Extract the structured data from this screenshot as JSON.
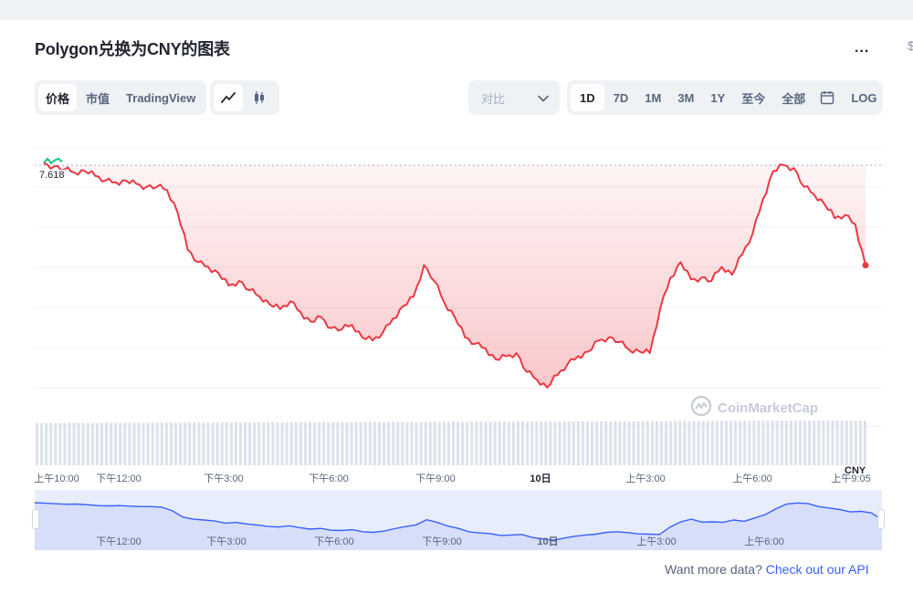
{
  "title": "Polygon兑换为CNY的图表",
  "more_label": "...",
  "right_edge_glyph": "$",
  "view_tabs": [
    {
      "label": "价格",
      "active": true
    },
    {
      "label": "市值",
      "active": false
    },
    {
      "label": "TradingView",
      "active": false
    }
  ],
  "chart_type_icons": [
    "line-chart-icon",
    "candlestick-icon"
  ],
  "compare": {
    "label": "对比",
    "icon": "chevron-down-icon"
  },
  "range_tabs": [
    {
      "label": "1D",
      "active": true
    },
    {
      "label": "7D",
      "active": false
    },
    {
      "label": "1M",
      "active": false
    },
    {
      "label": "3M",
      "active": false
    },
    {
      "label": "1Y",
      "active": false
    },
    {
      "label": "至今",
      "active": false
    },
    {
      "label": "全部",
      "active": false
    }
  ],
  "calendar_icon": "calendar-icon",
  "log_label": "LOG",
  "open_price_label": "7.618",
  "currency_label": "CNY",
  "watermark": "CoinMarketCap",
  "colors": {
    "down": "#ea3943",
    "up": "#16c784",
    "navigator_line": "#3861fb",
    "volume": "#cfd6e4",
    "link": "#3861fb"
  },
  "chart_data": {
    "type": "line",
    "reference_value": 7.618,
    "x_tick_labels": [
      "上午10:00",
      "下午12:00",
      "下午3:00",
      "下午6:00",
      "下午9:00",
      "10日",
      "上午3:00",
      "上午6:00",
      "上午9:05"
    ],
    "series": [
      {
        "values": [
          7.63,
          7.61,
          7.59,
          7.57,
          7.58,
          7.55,
          7.52,
          7.51,
          7.52,
          7.5,
          7.48,
          7.48,
          7.46,
          7.32,
          7.08,
          7.0,
          6.97,
          6.93,
          6.85,
          6.88,
          6.82,
          6.78,
          6.73,
          6.7,
          6.75,
          6.68,
          6.62,
          6.65,
          6.58,
          6.57,
          6.6,
          6.52,
          6.5,
          6.55,
          6.64,
          6.72,
          6.78,
          6.98,
          6.88,
          6.74,
          6.65,
          6.52,
          6.48,
          6.45,
          6.38,
          6.4,
          6.42,
          6.3,
          6.25,
          6.2,
          6.28,
          6.35,
          6.4,
          6.43,
          6.5,
          6.52,
          6.49,
          6.44,
          6.43,
          6.42,
          6.7,
          6.9,
          7.0,
          6.89,
          6.9,
          6.88,
          6.97,
          6.92,
          7.05,
          7.18,
          7.4,
          7.58,
          7.62,
          7.6,
          7.48,
          7.43,
          7.37,
          7.28,
          7.3,
          7.24,
          6.98
        ]
      }
    ],
    "volume_series": [
      0.45,
      0.46,
      0.46,
      0.47,
      0.47,
      0.48,
      0.48,
      0.49,
      0.49,
      0.5,
      0.5,
      0.51,
      0.51,
      0.52,
      0.52,
      0.53,
      0.53,
      0.54,
      0.54,
      0.55,
      0.55,
      0.56,
      0.56,
      0.57,
      0.57,
      0.58,
      0.58,
      0.59,
      0.59,
      0.6,
      0.6,
      0.61,
      0.61,
      0.62,
      0.62,
      0.63,
      0.63,
      0.64,
      0.64,
      0.65
    ],
    "grid": true,
    "legend": "none"
  },
  "navigator": {
    "labels": [
      "下午12:00",
      "下午3:00",
      "下午6:00",
      "下午9:00",
      "10日",
      "上午3:00",
      "上午6:00"
    ]
  },
  "footer": {
    "text": "Want more data?",
    "link": "Check out our API"
  }
}
